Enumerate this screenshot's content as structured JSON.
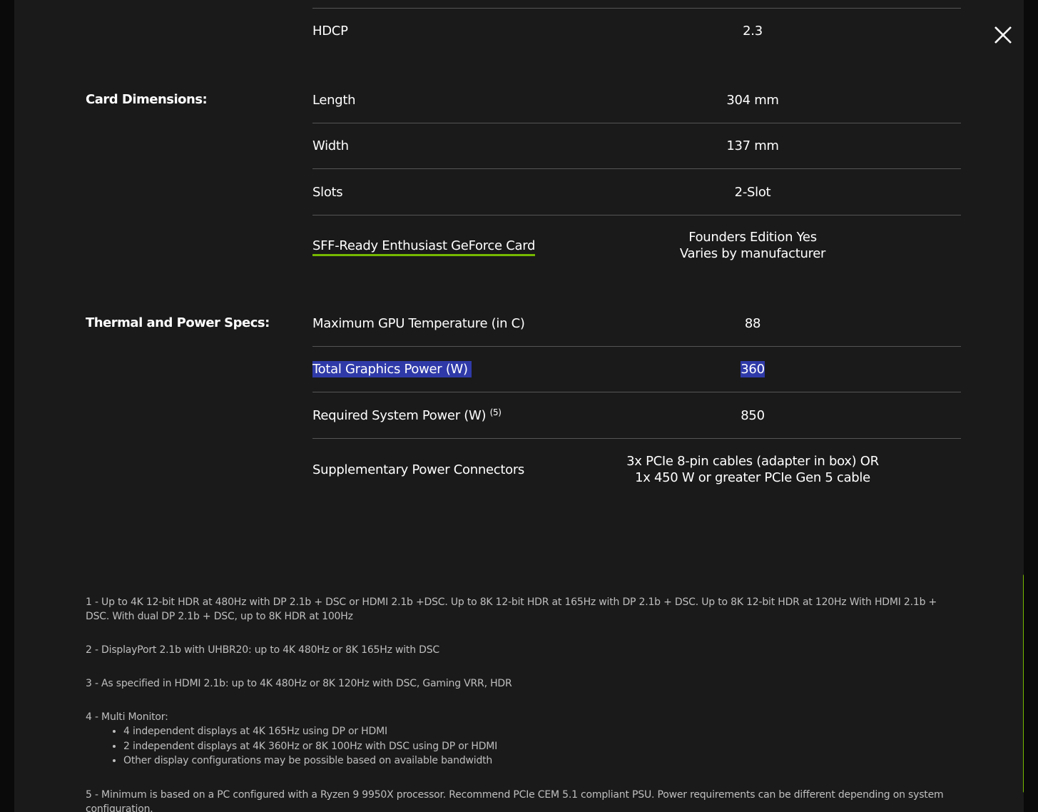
{
  "hdcp_row": {
    "label": "HDCP",
    "value": "2.3"
  },
  "card_dimensions": {
    "section_label": "Card Dimensions:",
    "rows": [
      {
        "label": "Length",
        "value": "304 mm"
      },
      {
        "label": "Width",
        "value": "137 mm"
      },
      {
        "label": "Slots",
        "value": "2-Slot"
      },
      {
        "label": "SFF-Ready Enthusiast GeForce Card",
        "value_line1": "Founders Edition Yes",
        "value_line2": "Varies by manufacturer"
      }
    ]
  },
  "thermal_power": {
    "section_label": "Thermal and Power Specs:",
    "rows": [
      {
        "label": "Maximum GPU Temperature (in C)",
        "value": "88"
      },
      {
        "label": "Total Graphics Power (W)",
        "value": "360"
      },
      {
        "label": "Required System Power (W)",
        "footnote": "(5)",
        "value": "850"
      },
      {
        "label": "Supplementary Power Connectors",
        "value_line1": "3x PCIe 8-pin cables (adapter in box) OR",
        "value_line2": "1x 450 W or greater PCIe Gen 5 cable"
      }
    ]
  },
  "footnotes": {
    "note1": "1 - Up to 4K 12-bit HDR at 480Hz with DP 2.1b + DSC or HDMI 2.1b +DSC. Up to 8K 12-bit HDR at 165Hz with DP 2.1b + DSC. Up to 8K 12-bit HDR at 120Hz With HDMI 2.1b + DSC. With dual DP 2.1b + DSC, up to 8K HDR at 100Hz",
    "note2": "2 - DisplayPort 2.1b with UHBR20: up to 4K 480Hz or 8K 165Hz with DSC",
    "note3": "3 - As specified in HDMI 2.1b: up to 4K 480Hz or 8K 120Hz with DSC, Gaming VRR, HDR",
    "note4": {
      "title": "4 - Multi Monitor:",
      "items": [
        "4 independent displays at 4K 165Hz using DP or HDMI",
        "2 independent displays at 4K 360Hz or 8K 100Hz with DSC using DP or HDMI",
        "Other display configurations may be possible based on available bandwidth"
      ]
    },
    "note5": "5 - Minimum is based on a PC configured with a Ryzen 9 9950X processor. Recommend PCIe CEM 5.1 compliant PSU. Power requirements can be different depending on system configuration."
  },
  "icons": {
    "close": "close-icon"
  },
  "colors": {
    "accent": "#76b900",
    "selection": "#2f3aa8",
    "background": "#1a1a1a"
  }
}
